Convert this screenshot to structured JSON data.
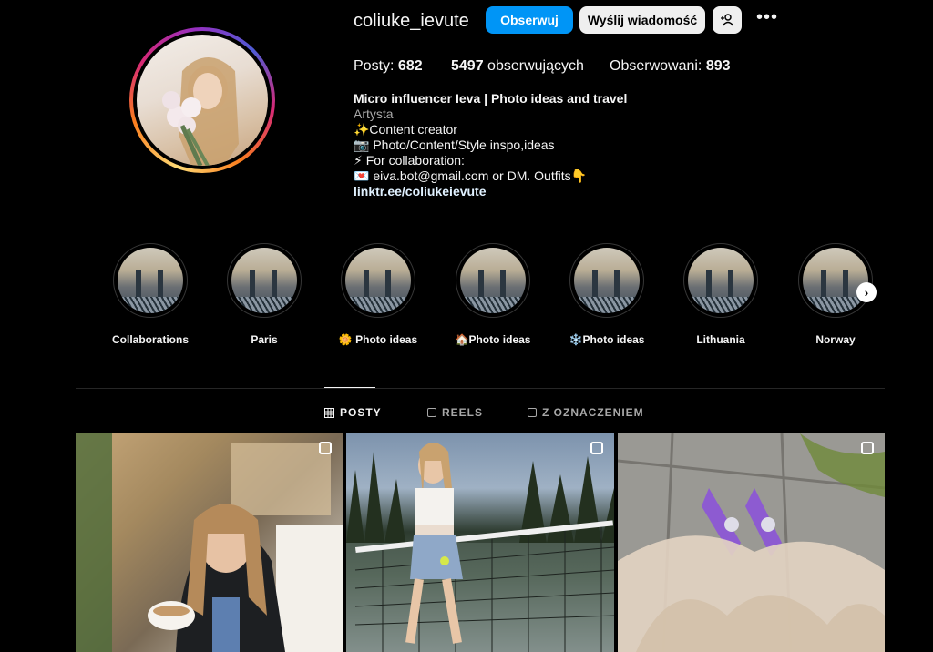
{
  "profile": {
    "username": "coliuke_ievute",
    "follow_label": "Obserwuj",
    "message_label": "Wyślij wiadomość",
    "stats": {
      "posts_label": "Posty:",
      "posts_value": "682",
      "followers_value": "5497",
      "followers_label": "obserwujących",
      "following_label": "Obserwowani:",
      "following_value": "893"
    },
    "bio": {
      "name": "Micro influencer Ieva | Photo ideas and travel",
      "category": "Artysta",
      "line1": "✨Content creator",
      "line2": "📷  Photo/Content/Style inspo,ideas",
      "line3": "⚡ For collaboration:",
      "line4": "💌  eiva.bot@gmail.com or DM. Outfits👇",
      "link": "linktr.ee/coliukeievute"
    }
  },
  "highlights": [
    {
      "label": "Collaborations"
    },
    {
      "label": "Paris"
    },
    {
      "label": "🌼 Photo ideas"
    },
    {
      "label": "🏠Photo ideas"
    },
    {
      "label": "❄️Photo ideas"
    },
    {
      "label": "Lithuania"
    },
    {
      "label": "Norway"
    }
  ],
  "tabs": [
    {
      "label": "POSTY"
    },
    {
      "label": "REELS"
    },
    {
      "label": "Z OZNACZENIEM"
    }
  ],
  "colors": {
    "accent": "#0095f6",
    "background": "#000000"
  }
}
